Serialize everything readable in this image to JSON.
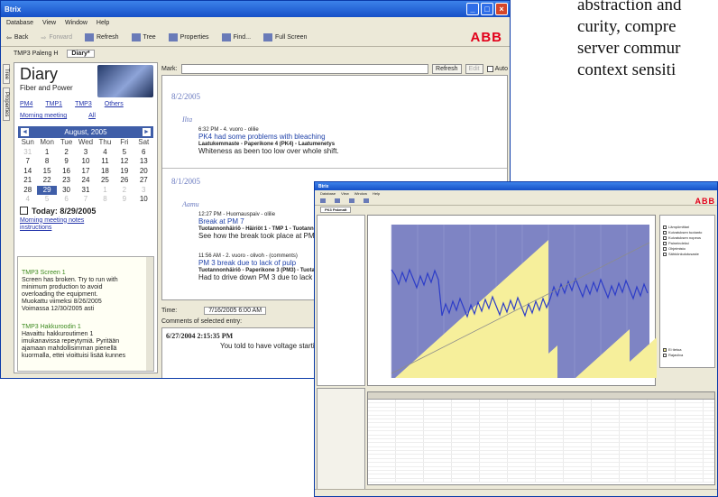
{
  "page_text": {
    "lines": [
      "abstraction and",
      "curity, compre",
      "server commur",
      "context sensiti"
    ]
  },
  "window_a": {
    "title": "Btrix",
    "menu": [
      "Database",
      "View",
      "Window",
      "Help"
    ],
    "toolbar": {
      "back": "Back",
      "forward": "Forward",
      "refresh": "Refresh",
      "tree": "Tree",
      "properties": "Properties",
      "find": "Find...",
      "fullscreen": "Full Screen"
    },
    "brand": "ABB",
    "tabs": [
      "TMP3 Paleng H",
      "Diary*"
    ],
    "side_tabs": [
      "Tree",
      "Properties"
    ],
    "diary": {
      "title": "Diary",
      "subtitle": "Fiber and Power",
      "links": [
        "PM4",
        "TMP1",
        "TMP3",
        "Others"
      ],
      "morning_meeting": "Morning meeting",
      "all": "All"
    },
    "calendar": {
      "month_label": "August, 2005",
      "prev": "◄",
      "next": "►",
      "weekdays": [
        "Sun",
        "Mon",
        "Tue",
        "Wed",
        "Thu",
        "Fri",
        "Sat"
      ],
      "days": [
        [
          "31",
          "1",
          "2",
          "3",
          "4",
          "5",
          "6"
        ],
        [
          "7",
          "8",
          "9",
          "10",
          "11",
          "12",
          "13"
        ],
        [
          "14",
          "15",
          "16",
          "17",
          "18",
          "19",
          "20"
        ],
        [
          "21",
          "22",
          "23",
          "24",
          "25",
          "26",
          "27"
        ],
        [
          "28",
          "29",
          "30",
          "31",
          "1",
          "2",
          "3"
        ],
        [
          "4",
          "5",
          "6",
          "7",
          "8",
          "9",
          "10"
        ]
      ],
      "selected_day": "29",
      "today_label": "Today: 8/29/2005"
    },
    "notes_link_lines": [
      "Morning meeting notes",
      "instructions"
    ],
    "notes": [
      {
        "heading": "TMP3 Screen 1",
        "lines": [
          "Screen has broken. Try to run with",
          "minimum production to avoid",
          "overloading the equipment.",
          "Muokattu viimeksi 8/26/2005",
          "Voimassa 12/30/2005 asti"
        ]
      },
      {
        "heading": "TMP3 Hakkuroodin 1",
        "lines": [
          "Havaittu hakkuroutimen 1",
          "imukanavissa repeytymiä. Pyritään",
          "ajamaan mahdollisimman pienellä",
          "kuormalla, ettei vioittuisi lisää kunnes"
        ]
      }
    ],
    "mark_label": "Mark:",
    "refresh_btn": "Refresh",
    "edit_btn": "Edit",
    "auto_label": "Auto",
    "entries": {
      "date1": "8/2/2005",
      "shift1": "Ilta",
      "e1_meta": "6:32 PM - 4. vuoro - olilie",
      "e1_title": "PK4 had some problems with bleaching",
      "e1_sub": "Laatukemmaste - Paperikone 4 (PK4) - Laatumenetys",
      "e1_body": "Whiteness as been too low over whole shift.",
      "date2": "8/1/2005",
      "shift2": "Aamu",
      "e2_meta": "12:27 PM - Huomauspaiv - olilie",
      "e2_title": "Break at PM 7",
      "e2_sub": "Tuotannonhäiriö - Häiriöt 1 - TMP 1 - Tuotannonmenetys",
      "e2_body": "See how the break took place at PM 7",
      "e3_meta": "11:56 AM - 2. vuoro - olivoh - (comments)",
      "e3_title": "PM 3 break due to lack of pulp",
      "e3_sub": "Tuotannonhäiriö - Paperikone 3 (PM3) - Tuotannonmene",
      "e3_body": "Had to drive down PM 3 due to lack of PG"
    },
    "time_label": "Time:",
    "time_value": "7/16/2005 6:00 AM",
    "comments_label": "Comments of selected entry:",
    "comment_time": "6/27/2004 2:15:35 PM",
    "comment_body": "You told to have voltage starting at 10:0"
  },
  "window_b": {
    "title": "Btrix",
    "menu": [
      "Database",
      "View",
      "Window",
      "Help"
    ],
    "brand": "ABB",
    "tab": "PK3 Pakmatt",
    "legend_items": [
      "Lämpömittari",
      "Kuivatuksen tuotanto",
      "Kuivatuksen nopeus",
      "Paineindeksi",
      "Ohjelmisto",
      "Sähkönkulutusaste"
    ],
    "legend_bottom": [
      "Ei tietoa",
      "Rajaviiva"
    ],
    "colors": {
      "chart_bg": "#7e84c4",
      "fill": "#f6ef9b",
      "series": "#2c3cc8",
      "trend": "#8c8c8c"
    }
  }
}
